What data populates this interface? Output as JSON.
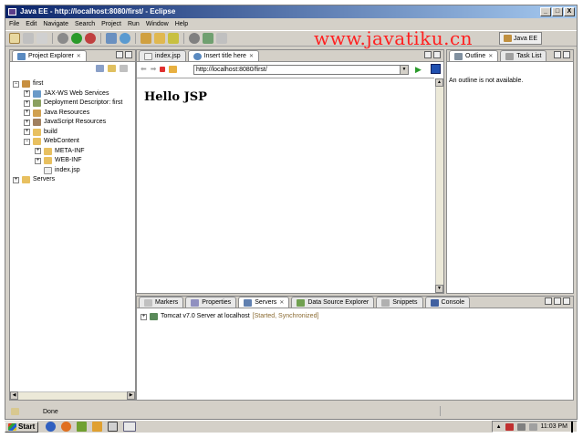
{
  "window": {
    "title": "Java EE - http://localhost:8080/first/ - Eclipse",
    "min": "_",
    "max": "□",
    "close": "X"
  },
  "menu": [
    "File",
    "Edit",
    "Navigate",
    "Search",
    "Project",
    "Run",
    "Window",
    "Help"
  ],
  "watermark": "www.javatiku.cn",
  "perspective": {
    "label": "Java EE"
  },
  "project_explorer": {
    "tab_label": "Project Explorer",
    "tree": [
      {
        "label": "first",
        "depth": 0,
        "expander": "−"
      },
      {
        "label": "JAX-WS Web Services",
        "depth": 1,
        "expander": "+"
      },
      {
        "label": "Deployment Descriptor: first",
        "depth": 1,
        "expander": "+"
      },
      {
        "label": "Java Resources",
        "depth": 1,
        "expander": "+"
      },
      {
        "label": "JavaScript Resources",
        "depth": 1,
        "expander": "+"
      },
      {
        "label": "build",
        "depth": 1,
        "expander": "+"
      },
      {
        "label": "WebContent",
        "depth": 1,
        "expander": "−"
      },
      {
        "label": "META-INF",
        "depth": 2,
        "expander": "+"
      },
      {
        "label": "WEB-INF",
        "depth": 2,
        "expander": "+"
      },
      {
        "label": "index.jsp",
        "depth": 2,
        "expander": ""
      },
      {
        "label": "Servers",
        "depth": 0,
        "expander": "+"
      }
    ]
  },
  "editor": {
    "tabs": [
      {
        "label": "index.jsp",
        "active": false
      },
      {
        "label": "Insert title here",
        "active": true
      }
    ],
    "url": "http://localhost:8080/first/",
    "content_heading": "Hello JSP"
  },
  "outline": {
    "tabs": [
      {
        "label": "Outline"
      },
      {
        "label": "Task List"
      }
    ],
    "message": "An outline is not available."
  },
  "bottom": {
    "tabs": [
      "Markers",
      "Properties",
      "Servers",
      "Data Source Explorer",
      "Snippets",
      "Console"
    ],
    "server_name": "Tomcat v7.0 Server at localhost",
    "server_status": "[Started, Synchronized]"
  },
  "status": {
    "text": "Done"
  },
  "taskbar": {
    "start": "Start",
    "clock": "11:03 PM"
  },
  "colors": {
    "title_start": "#0a246a",
    "title_end": "#a6caf0",
    "watermark": "#ff2020",
    "server_status": "#8b6b32"
  }
}
